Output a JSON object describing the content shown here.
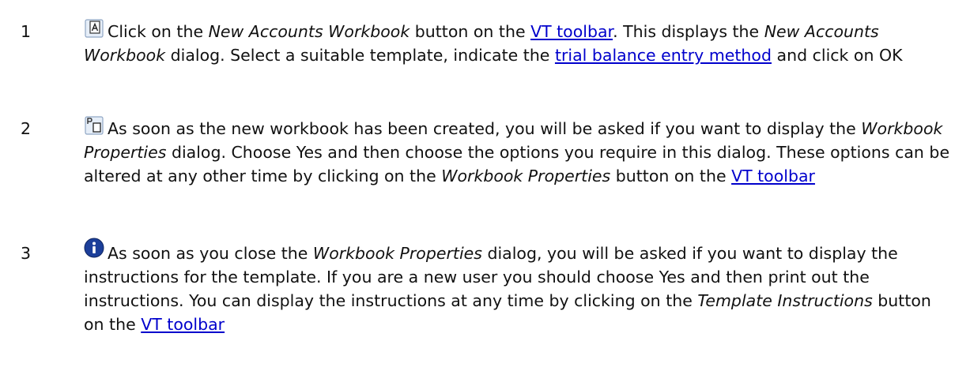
{
  "steps": [
    {
      "number": "1",
      "icon": "new-accounts-workbook-icon",
      "segments": [
        {
          "type": "text",
          "text": "Click on the "
        },
        {
          "type": "em",
          "text": "New Accounts Workbook"
        },
        {
          "type": "text",
          "text": " button on the "
        },
        {
          "type": "link",
          "text": "VT toolbar"
        },
        {
          "type": "text",
          "text": ". This displays the "
        },
        {
          "type": "em",
          "text": "New Accounts Workbook"
        },
        {
          "type": "text",
          "text": " dialog. Select a suitable template, indicate the "
        },
        {
          "type": "link",
          "text": "trial balance entry method"
        },
        {
          "type": "text",
          "text": " and click on OK"
        }
      ]
    },
    {
      "number": "2",
      "icon": "workbook-properties-icon",
      "segments": [
        {
          "type": "text",
          "text": "As soon as the new workbook has been created, you will be asked if you want to display the "
        },
        {
          "type": "em",
          "text": "Workbook Properties"
        },
        {
          "type": "text",
          "text": " dialog. Choose Yes and then choose the options you require in this dialog. These options can be altered at any other time by clicking on the "
        },
        {
          "type": "em",
          "text": "Workbook Properties"
        },
        {
          "type": "text",
          "text": " button on the "
        },
        {
          "type": "link",
          "text": "VT toolbar"
        }
      ]
    },
    {
      "number": "3",
      "icon": "template-instructions-icon",
      "segments": [
        {
          "type": "text",
          "text": "As soon as you close the "
        },
        {
          "type": "em",
          "text": "Workbook Properties"
        },
        {
          "type": "text",
          "text": " dialog, you will be asked if you want to display the instructions for the template. If you are a new user you should choose Yes and then print out the instructions. You can display the instructions at any time by clicking on the "
        },
        {
          "type": "em",
          "text": "Template Instructions"
        },
        {
          "type": "text",
          "text": " button on the "
        },
        {
          "type": "link",
          "text": "VT toolbar"
        }
      ]
    }
  ],
  "colors": {
    "link": "#0000cc",
    "text": "#111111",
    "info_icon": "#1c3f9a"
  }
}
